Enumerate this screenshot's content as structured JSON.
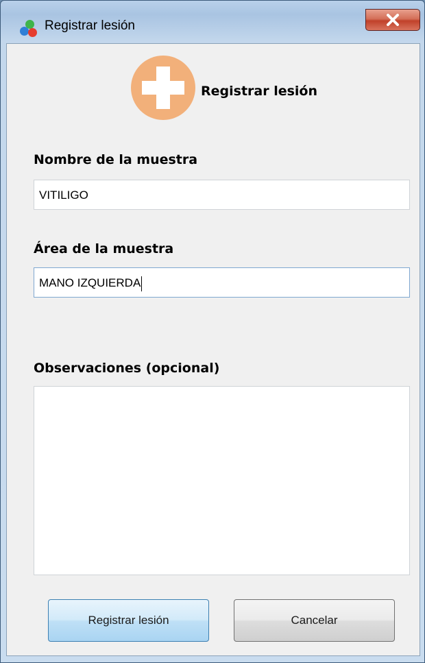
{
  "window": {
    "title": "Registrar lesión",
    "close_symbol": "X",
    "app_icon": "colored-dots-icon"
  },
  "header": {
    "icon": "add-circle-icon",
    "title": "Registrar lesión"
  },
  "form": {
    "name_label": "Nombre de la muestra",
    "name_value": "VITILIGO",
    "area_label": "Área de la muestra",
    "area_value": "MANO IZQUIERDA",
    "notes_label": "Observaciones (opcional)",
    "notes_value": ""
  },
  "buttons": {
    "submit_label": "Registrar lesión",
    "cancel_label": "Cancelar"
  },
  "colors": {
    "accent_orange": "#f2b07a",
    "focus_border": "#7ea7d0"
  }
}
